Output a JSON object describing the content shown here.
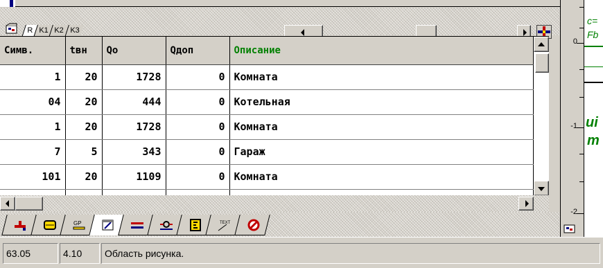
{
  "sheet_tabs": [
    "R",
    "K1",
    "K2",
    "K3"
  ],
  "active_sheet_tab": "R",
  "table": {
    "columns": [
      "Симв.",
      "tвн",
      "Qo",
      "Qдоп",
      "Описание"
    ],
    "rows": [
      [
        "1",
        "20",
        "1728",
        "0",
        "Комната"
      ],
      [
        "04",
        "20",
        "444",
        "0",
        "Котельная"
      ],
      [
        "1",
        "20",
        "1728",
        "0",
        "Комната"
      ],
      [
        "7",
        "5",
        "343",
        "0",
        "Гараж"
      ],
      [
        "101",
        "20",
        "1109",
        "0",
        "Комната"
      ]
    ]
  },
  "toolbar_tabs": [
    {
      "icon": "valve-icon"
    },
    {
      "icon": "radiator-icon"
    },
    {
      "icon": "gp-icon",
      "label": "GP"
    },
    {
      "icon": "drawing-area-icon"
    },
    {
      "icon": "pipes-icon"
    },
    {
      "icon": "pump-icon"
    },
    {
      "icon": "schedule-icon"
    },
    {
      "icon": "text-icon",
      "label": "TEXT"
    },
    {
      "icon": "prohibit-icon"
    }
  ],
  "active_toolbar_tab": 3,
  "status": {
    "x": "63.05",
    "y": "4.10",
    "message": "Область рисунка."
  },
  "ruler": {
    "labels": [
      "0",
      "-1",
      "-2"
    ]
  },
  "drawing_fragments": {
    "line1": "c=",
    "line2": "Fb",
    "line3": "ui",
    "line4": "m"
  },
  "colors": {
    "accent_green": "#008000",
    "navy": "#000080"
  }
}
